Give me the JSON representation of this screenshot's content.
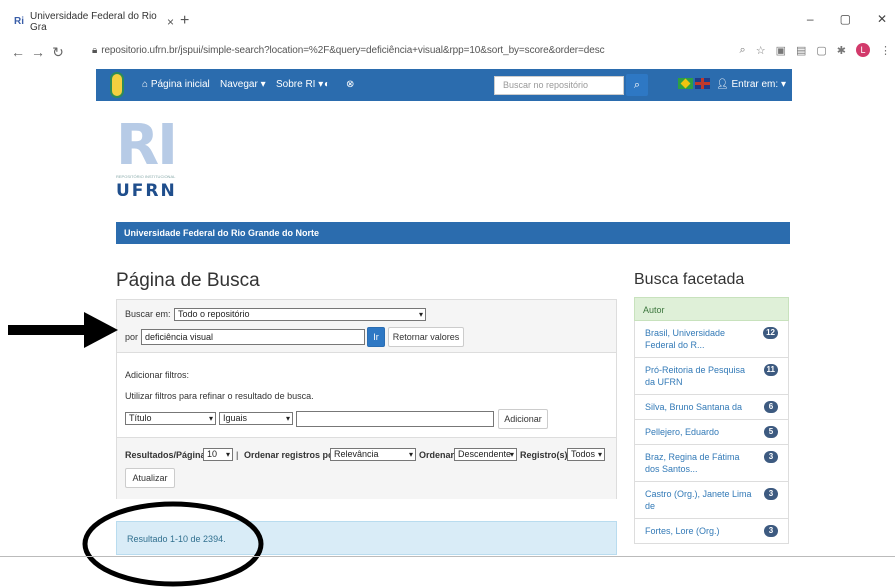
{
  "browser": {
    "tab_title": "Universidade Federal do Rio Gra",
    "tab_close": "×",
    "new_tab": "+",
    "url": "repositorio.ufrn.br/jspui/simple-search?location=%2F&query=deficiência+visual&rpp=10&sort_by=score&order=desc",
    "window_controls": [
      "–",
      "▢",
      "✕"
    ],
    "profile_initial": "L"
  },
  "navbar": {
    "home": "Página inicial",
    "browse": "Navegar",
    "about": "Sobre RI",
    "search_placeholder": "Buscar no repositório",
    "login": "Entrar em:"
  },
  "logo": {
    "letters": "RI",
    "subtitle": "REPOSITÓRIO INSTITUCIONAL",
    "org": "UFRN"
  },
  "banner": {
    "text": "Universidade Federal do Rio Grande do Norte"
  },
  "page": {
    "title": "Página de Busca"
  },
  "search": {
    "scope_label": "Buscar em:",
    "scope_value": "Todo o repositório",
    "by_label": "por",
    "query": "deficiência visual",
    "go_button": "Ir",
    "reset_button": "Retornar valores",
    "filters_title": "Adicionar filtros:",
    "filters_help": "Utilizar filtros para refinar o resultado de busca.",
    "filter_field": "Título",
    "filter_op": "Iguais",
    "filter_value": "",
    "add_button": "Adicionar",
    "rpp_label": "Resultados/Página",
    "rpp_value": "10",
    "sep": "|",
    "sort_label": "Ordenar registros por",
    "sort_value": "Relevância",
    "order_label": "Ordenar",
    "order_value": "Descendente",
    "records_label": "Registro(s)",
    "records_value": "Todos",
    "update_button": "Atualizar"
  },
  "results": {
    "summary": "Resultado 1-10 de 2394."
  },
  "facets": {
    "title": "Busca facetada",
    "group": "Autor",
    "items": [
      {
        "label": "Brasil, Universidade Federal do R...",
        "count": "12"
      },
      {
        "label": "Pró-Reitoria de Pesquisa da UFRN",
        "count": "11"
      },
      {
        "label": "Silva, Bruno Santana da",
        "count": "6"
      },
      {
        "label": "Pellejero, Eduardo",
        "count": "5"
      },
      {
        "label": "Braz, Regina de Fátima dos Santos...",
        "count": "3"
      },
      {
        "label": "Castro (Org.), Janete Lima de",
        "count": "3"
      },
      {
        "label": "Fortes, Lore (Org.)",
        "count": "3"
      }
    ]
  }
}
